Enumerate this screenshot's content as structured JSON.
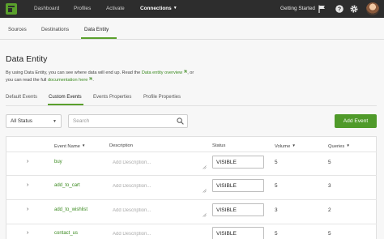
{
  "topnav": {
    "items": [
      {
        "label": "Dashboard"
      },
      {
        "label": "Profiles"
      },
      {
        "label": "Activate"
      },
      {
        "label": "Connections",
        "active": true
      }
    ],
    "getting_started": "Getting Started",
    "icons": [
      "app-logo",
      "flag-icon",
      "help-icon",
      "settings-icon",
      "avatar"
    ]
  },
  "subnav": {
    "items": [
      "Sources",
      "Destinations",
      "Data Entity"
    ],
    "active": "Data Entity"
  },
  "page": {
    "title": "Data Entity",
    "desc_part1": "By using Data Entity, you can see where data will end up. Read the ",
    "desc_link1": "Data entity overview",
    "desc_part2": ", or you can read the full ",
    "desc_link2": "documentation here",
    "desc_part3": "."
  },
  "tabs": [
    "Default Events",
    "Custom Events",
    "Events Properties",
    "Profile Properties"
  ],
  "active_tab": "Custom Events",
  "filters": {
    "status_selected": "All Status",
    "search_placeholder": "Search",
    "add_button": "Add Event"
  },
  "table": {
    "headers": {
      "event_name": "Event Name",
      "description": "Description",
      "status": "Status",
      "volume": "Volume",
      "queries": "Queries"
    },
    "description_placeholder": "Add Description...",
    "rows": [
      {
        "name": "buy",
        "status": "VISIBLE",
        "volume": "5",
        "queries": "5"
      },
      {
        "name": "add_to_cart",
        "status": "VISIBLE",
        "volume": "5",
        "queries": "3"
      },
      {
        "name": "add_to_wishlist",
        "status": "VISIBLE",
        "volume": "3",
        "queries": "2"
      },
      {
        "name": "contact_us",
        "status": "VISIBLE",
        "volume": "5",
        "queries": "5"
      }
    ]
  },
  "colors": {
    "nav_bg": "#2d2d2d",
    "accent_green": "#4f9a2a",
    "link_green": "#3a8a1f"
  }
}
